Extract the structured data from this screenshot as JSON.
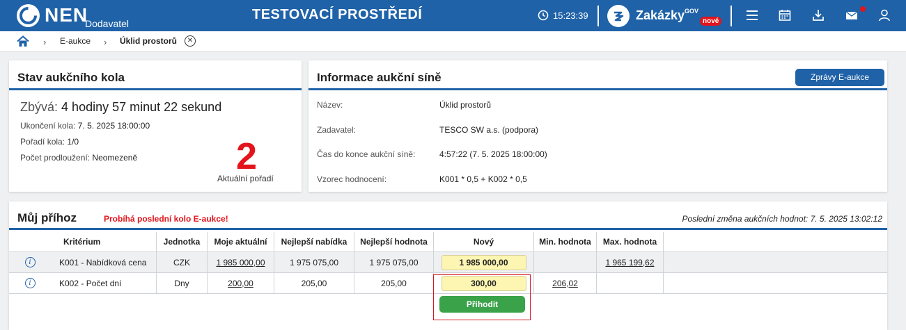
{
  "header": {
    "brand": "NEN",
    "brand_sub": "Dodavatel",
    "env_title": "TESTOVACÍ PROSTŘEDÍ",
    "clock": "15:23:39",
    "zakazky": "Zakázky",
    "gov": "GOV",
    "badge": "nové",
    "icons": [
      "menu-icon",
      "calendar-icon",
      "download-icon",
      "mail-icon",
      "user-icon"
    ]
  },
  "breadcrumb": {
    "items": [
      "E-aukce",
      "Úklid prostorů"
    ]
  },
  "stav": {
    "title": "Stav aukčního kola",
    "zbyva_label": "Zbývá:",
    "zbyva_value": "4 hodiny 57 minut 22 sekund",
    "ukonceni_label": "Ukončení kola:",
    "ukonceni_value": "7. 5. 2025 18:00:00",
    "poradi_label": "Pořadí kola:",
    "poradi_value": "1/0",
    "prodlouzeni_label": "Počet prodloužení:",
    "prodlouzeni_value": "Neomezeně",
    "aktualni_poradi": "2",
    "aktualni_poradi_label": "Aktuální pořadí"
  },
  "info": {
    "title": "Informace aukční síně",
    "button": "Zprávy E-aukce",
    "rows": [
      {
        "label": "Název:",
        "value": "Úklid prostorů"
      },
      {
        "label": "Zadavatel:",
        "value": "TESCO SW a.s. (podpora)"
      },
      {
        "label": "Čas do konce aukční síně:",
        "value": "4:57:22 (7. 5. 2025 18:00:00)"
      },
      {
        "label": "Vzorec hodnocení:",
        "value": "K001 * 0,5 + K002 * 0,5"
      }
    ]
  },
  "prihoz": {
    "title": "Můj příhoz",
    "warning": "Probíhá poslední kolo E-aukce!",
    "last_change": "Poslední změna aukčních hodnot: 7. 5. 2025 13:02:12",
    "columns": [
      "Kritérium",
      "Jednotka",
      "Moje aktuální",
      "Nejlepší nabídka",
      "Nejlepší hodnota",
      "Nový",
      "Min. hodnota",
      "Max. hodnota"
    ],
    "rows": [
      {
        "kriterium": "K001 - Nabídková cena",
        "jednotka": "CZK",
        "moje": "1 985 000,00",
        "nej_nabidka": "1 975 075,00",
        "nej_hodnota": "1 975 075,00",
        "novy": "1 985 000,00",
        "min": "",
        "max": "1 965 199,62"
      },
      {
        "kriterium": "K002 - Počet dní",
        "jednotka": "Dny",
        "moje": "200,00",
        "nej_nabidka": "205,00",
        "nej_hodnota": "205,00",
        "novy": "300,00",
        "min": "206,02",
        "max": ""
      }
    ],
    "submit": "Přihodit"
  },
  "colors": {
    "primary": "#1f62a8",
    "danger": "#e3141b",
    "success": "#3aa34a",
    "input_bg": "#fdf6b2"
  }
}
